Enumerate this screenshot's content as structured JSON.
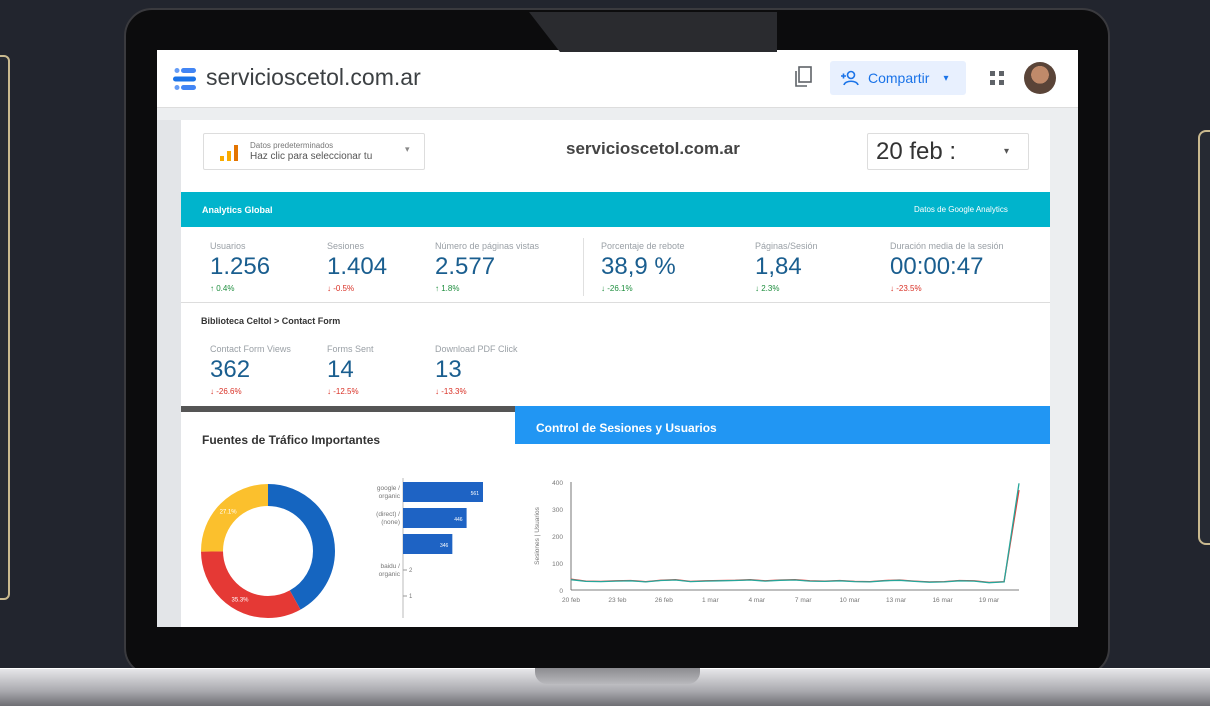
{
  "app": {
    "title": "servicioscetol.com.ar",
    "share_label": "Compartir",
    "share_arrow": "▾"
  },
  "report": {
    "data_source_line1": "Datos predeterminados",
    "data_source_line2": "Haz clic para seleccionar tu",
    "data_source_arrow": "▾",
    "title": "servicioscetol.com.ar",
    "date": "20 feb :",
    "date_arrow": "▾"
  },
  "analytics": {
    "section_title": "Analytics Global",
    "source_label": "Datos de Google Analytics",
    "kpis": [
      {
        "label": "Usuarios",
        "value": "1.256",
        "change": "↑ 0.4%",
        "trend": "up"
      },
      {
        "label": "Sesiones",
        "value": "1.404",
        "change": "↓ -0.5%",
        "trend": "down"
      },
      {
        "label": "Número de páginas vistas",
        "value": "2.577",
        "change": "↑ 1.8%",
        "trend": "up"
      },
      {
        "label": "Porcentaje de rebote",
        "value": "38,9 %",
        "change": "↓ -26.1%",
        "trend": "up"
      },
      {
        "label": "Páginas/Sesión",
        "value": "1,84",
        "change": "↓ 2.3%",
        "trend": "up"
      },
      {
        "label": "Duración media de la sesión",
        "value": "00:00:47",
        "change": "↓ -23.5%",
        "trend": "down"
      }
    ]
  },
  "biblioteca": {
    "section_title": "Biblioteca Celtol > Contact Form",
    "kpis": [
      {
        "label": "Contact Form Views",
        "value": "362",
        "change": "↓ -26.6%",
        "trend": "down"
      },
      {
        "label": "Forms Sent",
        "value": "14",
        "change": "↓ -12.5%",
        "trend": "down"
      },
      {
        "label": "Download PDF Click",
        "value": "13",
        "change": "↓ -13.3%",
        "trend": "down"
      }
    ]
  },
  "traffic": {
    "title": "Fuentes de Tráfico Importantes",
    "donut": [
      {
        "label": "",
        "value": 45,
        "color": "#1565c0"
      },
      {
        "label": "35.3%",
        "value": 35.3,
        "color": "#e53935"
      },
      {
        "label": "27.1%",
        "value": 27.1,
        "color": "#fbc02d"
      }
    ],
    "bars": [
      {
        "label1": "google /",
        "label2": "organic",
        "value_label": "561",
        "value": 561
      },
      {
        "label1": "(direct) /",
        "label2": "(none)",
        "value_label": "446",
        "value": 446
      },
      {
        "label1": "",
        "label2": "",
        "value_label": "346",
        "value": 346
      },
      {
        "label1": "baidu /",
        "label2": "organic",
        "value_label": "2",
        "value": 2
      },
      {
        "label1": "",
        "label2": "",
        "value_label": "1",
        "value": 1
      }
    ]
  },
  "control": {
    "title": "Control de Sesiones y Usuarios"
  },
  "chart_data": {
    "type": "line",
    "title": "Control de Sesiones y Usuarios",
    "xlabel": "",
    "ylabel": "Sesiones | Usuarios",
    "ylim": [
      0,
      400
    ],
    "yticks": [
      "0",
      "100",
      "200",
      "300",
      "400"
    ],
    "xticks": [
      "20 feb",
      "23 feb",
      "26 feb",
      "1 mar",
      "4 mar",
      "7 mar",
      "10 mar",
      "13 mar",
      "16 mar",
      "19 mar"
    ],
    "series": [
      {
        "color": "#e53935",
        "values": [
          40,
          33,
          32,
          34,
          35,
          31,
          36,
          38,
          32,
          34,
          35,
          36,
          38,
          34,
          37,
          38,
          34,
          33,
          35,
          32,
          31,
          35,
          37,
          33,
          30,
          31,
          35,
          34,
          28,
          31,
          370
        ]
      },
      {
        "color": "#26a69a",
        "values": [
          38,
          32,
          31,
          33,
          34,
          30,
          35,
          37,
          31,
          33,
          34,
          35,
          37,
          33,
          36,
          37,
          33,
          32,
          34,
          31,
          30,
          34,
          36,
          32,
          29,
          30,
          34,
          33,
          27,
          30,
          395
        ]
      }
    ]
  }
}
